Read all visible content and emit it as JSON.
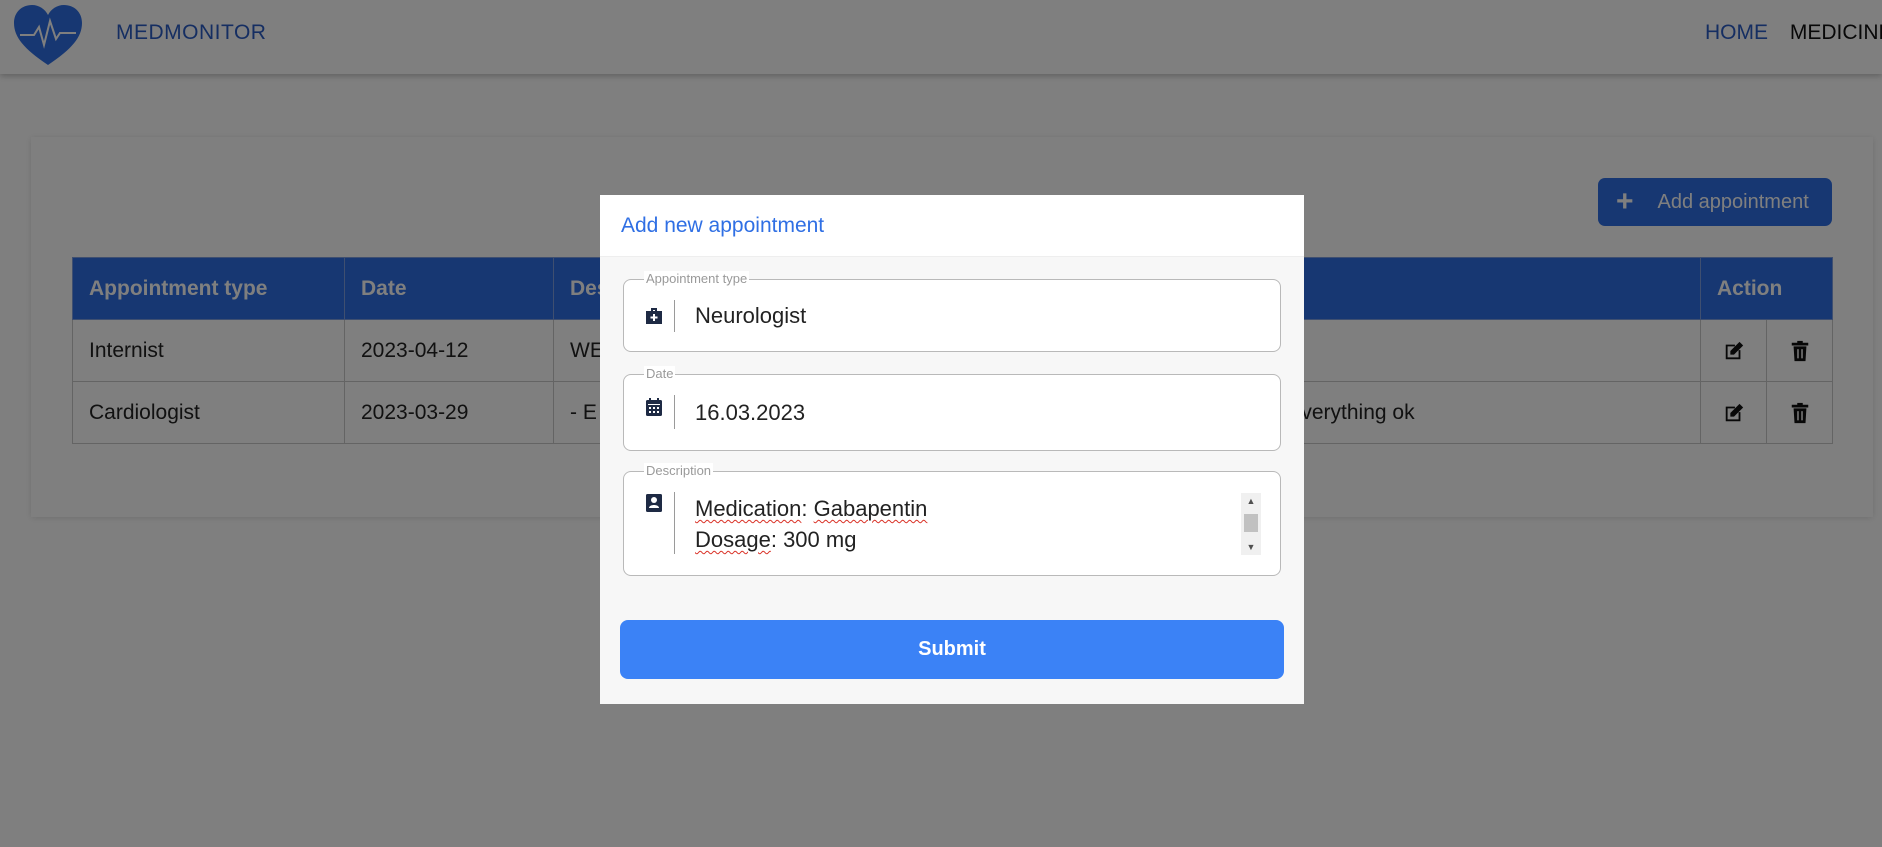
{
  "navbar": {
    "brand": "MEDMONITOR",
    "links": [
      "HOME",
      "MEDICINE"
    ],
    "logo_icon": "heart-pulse-icon"
  },
  "toolbar": {
    "add_label": "Add appointment",
    "add_icon": "plus-icon"
  },
  "table": {
    "headers": [
      "Appointment type",
      "Date",
      "Des",
      "Action"
    ],
    "rows": [
      {
        "type": "Internist",
        "date": "2023-04-12",
        "description_left": "WE",
        "description_right": ""
      },
      {
        "type": "Cardiologist",
        "date": "2023-03-29",
        "description_left": "- E",
        "description_right": "everything ok"
      }
    ],
    "action_icons": [
      "edit-icon",
      "trash-icon"
    ]
  },
  "modal": {
    "title": "Add new appointment",
    "fields": {
      "type": {
        "legend": "Appointment type",
        "value": "Neurologist",
        "icon": "medical-kit-icon"
      },
      "date": {
        "legend": "Date",
        "value": "16.03.2023",
        "icon": "calendar-icon"
      },
      "description": {
        "legend": "Description",
        "line1_word1": "Medication",
        "line1_rest": ": ",
        "line1_word2": "Gabapentin",
        "line2_word1": "Dosage",
        "line2_rest": ": 300 mg",
        "icon": "contact-book-icon"
      }
    },
    "submit_label": "Submit"
  },
  "colors": {
    "primary": "#2f6fe4",
    "submit": "#3b82f6",
    "overlay": "rgba(0,0,0,0.5)"
  }
}
